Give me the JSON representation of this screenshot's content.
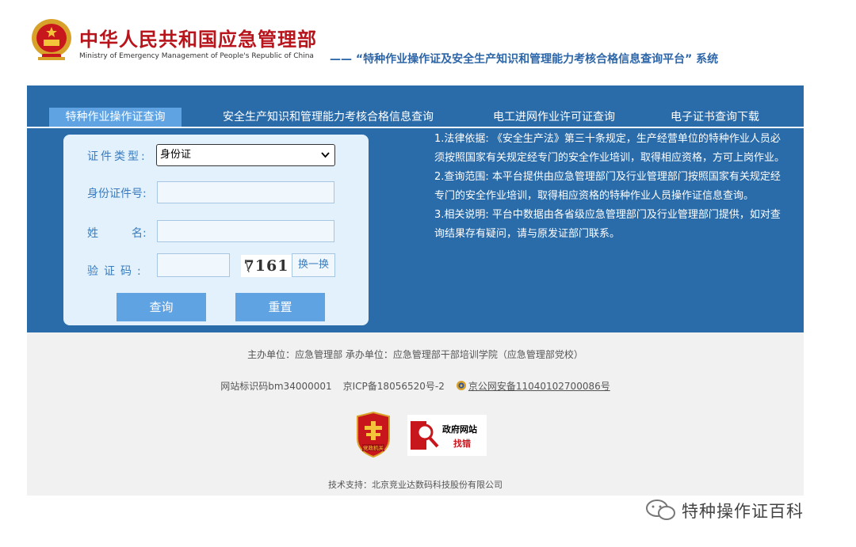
{
  "header": {
    "ministry_cn": "中华人民共和国应急管理部",
    "ministry_en": "Ministry of Emergency Management of People's Republic of China",
    "system_title": "—— “特种作业操作证及安全生产知识和管理能力考核合格信息查询平台” 系统"
  },
  "tabs": [
    {
      "label": "特种作业操作证查询",
      "active": true
    },
    {
      "label": "安全生产知识和管理能力考核合格信息查询",
      "active": false
    },
    {
      "label": "电工进网作业许可证查询",
      "active": false
    },
    {
      "label": "电子证书查询下载",
      "active": false
    }
  ],
  "form": {
    "cert_type_label": "证件类型:",
    "cert_type_value": "身份证",
    "id_label": "身份证件号:",
    "id_value": "",
    "name_label_a": "姓",
    "name_label_b": "名:",
    "name_value": "",
    "code_label": "验证码:",
    "code_value": "",
    "captcha_text": "7161",
    "refresh_label": "换一换",
    "query_label": "查询",
    "reset_label": "重置"
  },
  "notes": [
    "1.法律依据: 《安全生产法》第三十条规定，生产经营单位的特种作业人员必须按照国家有关规定经专门的安全作业培训，取得相应资格，方可上岗作业。",
    "2.查询范围: 本平台提供由应急管理部门及行业管理部门按照国家有关规定经专门的安全作业培训，取得相应资格的特种作业人员操作证信息查询。",
    "3.相关说明: 平台中数据由各省级应急管理部门及行业管理部门提供，如对查询结果存有疑问，请与原发证部门联系。"
  ],
  "footer": {
    "organizer": "主办单位：应急管理部    承办单位：应急管理部干部培训学院（应急管理部党校）",
    "site_id": "网站标识码bm34000001",
    "icp": "京ICP备18056520号-2",
    "police_record": "京公网安备11040102700086号",
    "badge1_text": "党政机关",
    "badge2_line1": "政府网站",
    "badge2_line2": "找错",
    "tech_support": "技术支持：北京竞业达数码科技股份有限公司"
  },
  "watermark": {
    "text": "特种操作证百科"
  },
  "colors": {
    "brand_red": "#b8141c",
    "band_blue": "#2a6baa",
    "accent_blue": "#5fa3e3",
    "title_blue": "#2d66a8"
  }
}
